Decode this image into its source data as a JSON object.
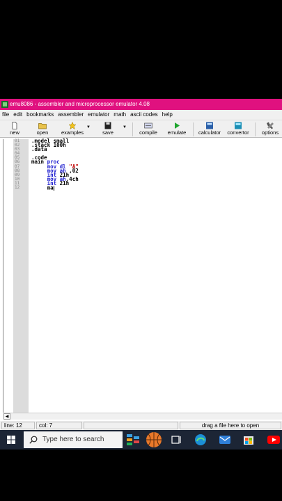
{
  "window": {
    "title": "emu8086 - assembler and microprocessor emulator 4.08"
  },
  "menu": [
    "file",
    "edit",
    "bookmarks",
    "assembler",
    "emulator",
    "math",
    "ascii codes",
    "help"
  ],
  "toolbar": {
    "new": "new",
    "open": "open",
    "examples": "examples",
    "save": "save",
    "compile": "compile",
    "emulate": "emulate",
    "calculator": "calculator",
    "convertor": "convertor",
    "options": "options"
  },
  "editor": {
    "line_numbers": [
      "01",
      "02",
      "03",
      "04",
      "05",
      "06",
      "07",
      "08",
      "09",
      "10",
      "11",
      "12"
    ],
    "lines": [
      ".model small",
      ".stack 100h",
      ".data",
      "",
      ".code",
      "main proc",
      "     mov dl \"A\"",
      "     mov ah ,02",
      "     int 21h",
      "     mov ah,4ch",
      "     int 21h",
      "     ma"
    ]
  },
  "status": {
    "line": "line: 12",
    "col": "col: 7",
    "drag": "drag a file here to open"
  },
  "taskbar": {
    "search_placeholder": "Type here to search"
  },
  "colors": {
    "title_bar": "#e0117f",
    "keyword": "#2020d0",
    "string": "#c00000",
    "taskbar": "#1c2535"
  }
}
